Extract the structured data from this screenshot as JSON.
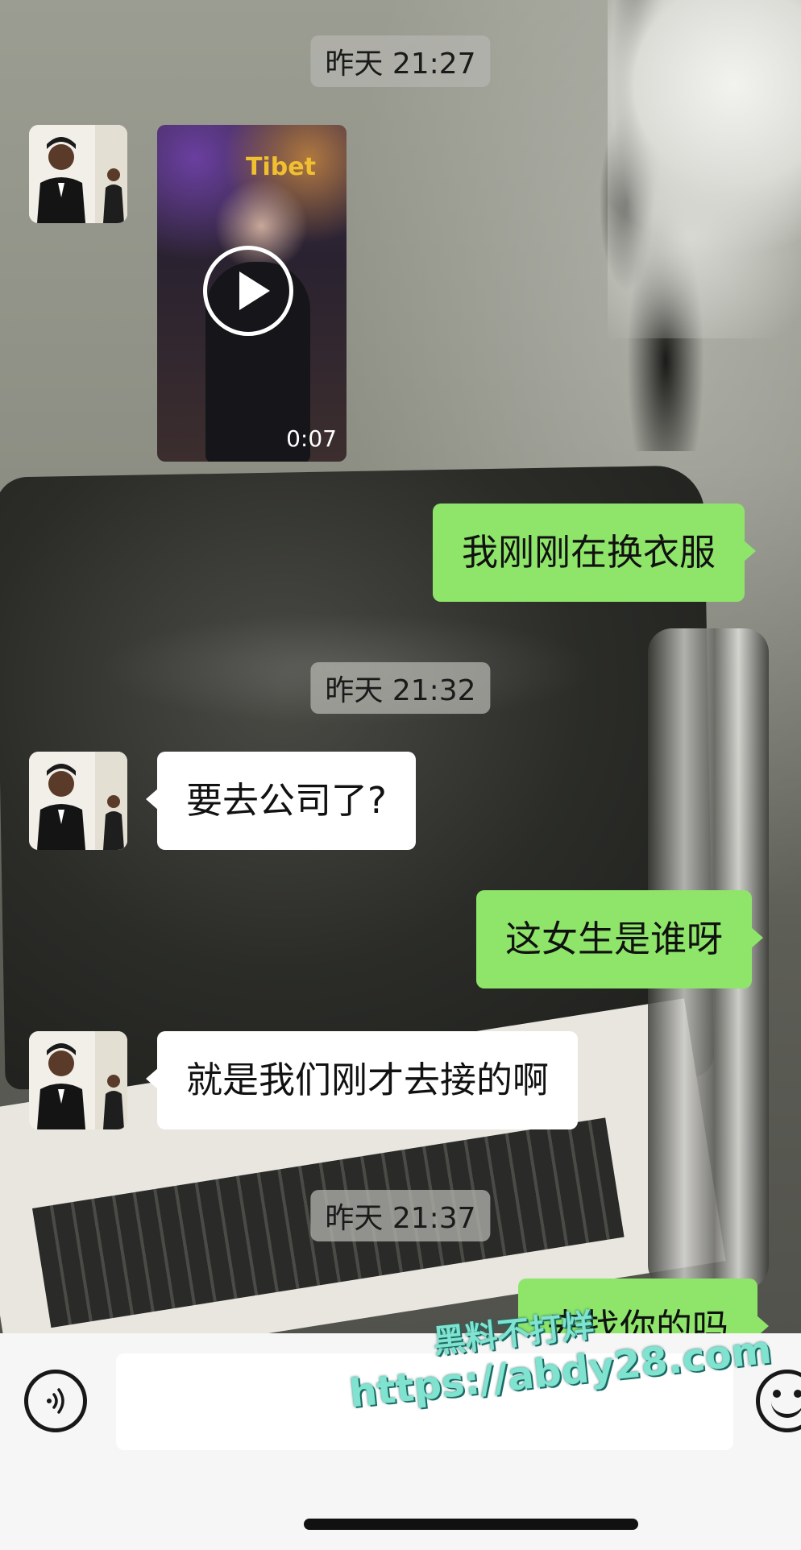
{
  "chat": {
    "timestamps": [
      "昨天 21:27",
      "昨天 21:32",
      "昨天 21:37"
    ],
    "video": {
      "duration": "0:07",
      "sign_text": "Tibet"
    },
    "messages": [
      {
        "side": "right",
        "text": "我刚刚在换衣服"
      },
      {
        "side": "left",
        "text": "要去公司了?"
      },
      {
        "side": "right",
        "text": "这女生是谁呀"
      },
      {
        "side": "left",
        "text": "就是我们刚才去接的啊"
      },
      {
        "side": "right",
        "text": "去找你的吗"
      }
    ]
  },
  "input": {
    "placeholder": "",
    "voice_icon": "voice-icon",
    "emoji_icon": "emoji-icon"
  },
  "watermark": {
    "line1": "黑料不打烊",
    "line2": "https://abdy28.com"
  },
  "colors": {
    "bubble_self": "#8ee56a",
    "bubble_other": "#ffffff"
  }
}
